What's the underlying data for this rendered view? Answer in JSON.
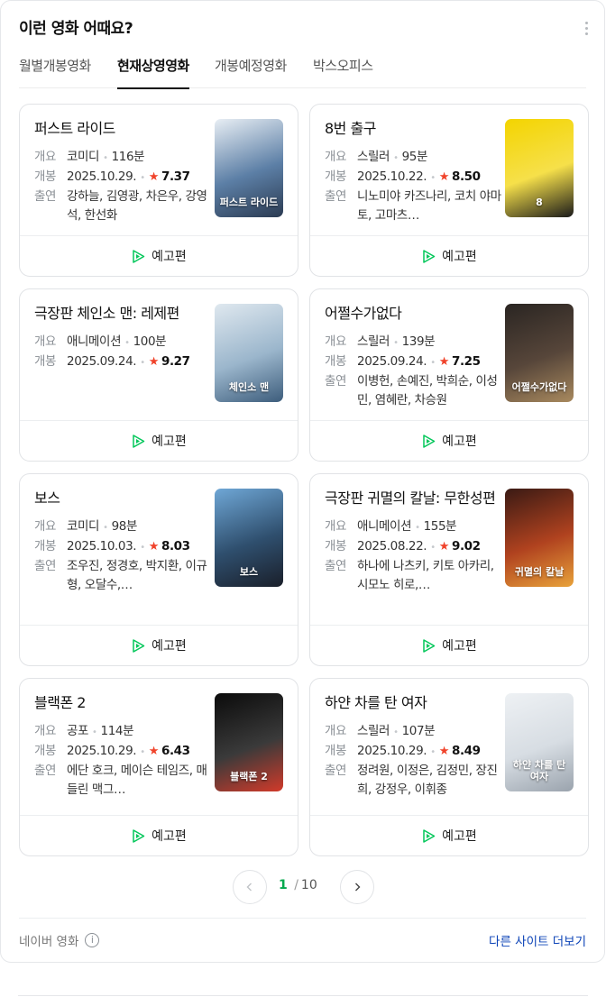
{
  "header": {
    "title": "이런 영화 어때요?"
  },
  "tabs": [
    {
      "label": "월별개봉영화"
    },
    {
      "label": "현재상영영화",
      "active": true
    },
    {
      "label": "개봉예정영화"
    },
    {
      "label": "박스오피스"
    }
  ],
  "labels": {
    "summary": "개요",
    "release": "개봉",
    "cast": "출연",
    "trailer": "예고편"
  },
  "movies": [
    {
      "title": "퍼스트 라이드",
      "genre": "코미디",
      "runtime": "116분",
      "date": "2025.10.29.",
      "rating": "7.37",
      "cast": "강하늘, 김영광, 차은우, 강영석, 한선화",
      "poster_colors": [
        "#e8eef4",
        "#5c7fa6",
        "#2b3b52"
      ],
      "poster_text": "퍼스트 라이드"
    },
    {
      "title": "8번 출구",
      "genre": "스릴러",
      "runtime": "95분",
      "date": "2025.10.22.",
      "rating": "8.50",
      "cast": "니노미야 카즈나리, 코치 야마토, 고마츠…",
      "poster_colors": [
        "#f3d400",
        "#f6e04a",
        "#1a1a1a"
      ],
      "poster_text": "8"
    },
    {
      "title": "극장판 체인소 맨: 레제편",
      "genre": "애니메이션",
      "runtime": "100분",
      "date": "2025.09.24.",
      "rating": "9.27",
      "cast": "",
      "poster_colors": [
        "#dfe8ef",
        "#9bb6cc",
        "#3d5d7c"
      ],
      "poster_text": "체인소 맨"
    },
    {
      "title": "어쩔수가없다",
      "genre": "스릴러",
      "runtime": "139분",
      "date": "2025.09.24.",
      "rating": "7.25",
      "cast": "이병헌, 손예진, 박희순, 이성민, 염혜란, 차승원",
      "poster_colors": [
        "#2a2522",
        "#57463a",
        "#a8895e"
      ],
      "poster_text": "어쩔수가없다"
    },
    {
      "title": "보스",
      "genre": "코미디",
      "runtime": "98분",
      "date": "2025.10.03.",
      "rating": "8.03",
      "cast": "조우진, 정경호, 박지환, 이규형, 오달수,…",
      "poster_colors": [
        "#6fa7d6",
        "#2f4f6e",
        "#1a1f2a"
      ],
      "poster_text": "보스"
    },
    {
      "title": "극장판 귀멸의 칼날: 무한성편",
      "genre": "애니메이션",
      "runtime": "155분",
      "date": "2025.08.22.",
      "rating": "9.02",
      "cast": "하나에 나츠키, 키토 아카리, 시모노 히로,…",
      "poster_colors": [
        "#3a1a14",
        "#b0421f",
        "#e8a23a"
      ],
      "poster_text": "귀멸의 칼날"
    },
    {
      "title": "블랙폰 2",
      "genre": "공포",
      "runtime": "114분",
      "date": "2025.10.29.",
      "rating": "6.43",
      "cast": "에단 호크, 메이슨 테임즈, 매들린 맥그…",
      "poster_colors": [
        "#0b0b0b",
        "#3a3a3a",
        "#d23a2a"
      ],
      "poster_text": "블랙폰 2"
    },
    {
      "title": "하얀 차를 탄 여자",
      "genre": "스릴러",
      "runtime": "107분",
      "date": "2025.10.29.",
      "rating": "8.49",
      "cast": "정려원, 이정은, 김정민, 장진희, 강정우, 이휘종",
      "poster_colors": [
        "#eef1f4",
        "#d7dde3",
        "#9aa3ad"
      ],
      "poster_text": "하얀 차를 탄 여자"
    }
  ],
  "pager": {
    "current": "1",
    "total": "10"
  },
  "footer": {
    "source": "네이버 영화",
    "more_sites": "다른 사이트 더보기"
  }
}
